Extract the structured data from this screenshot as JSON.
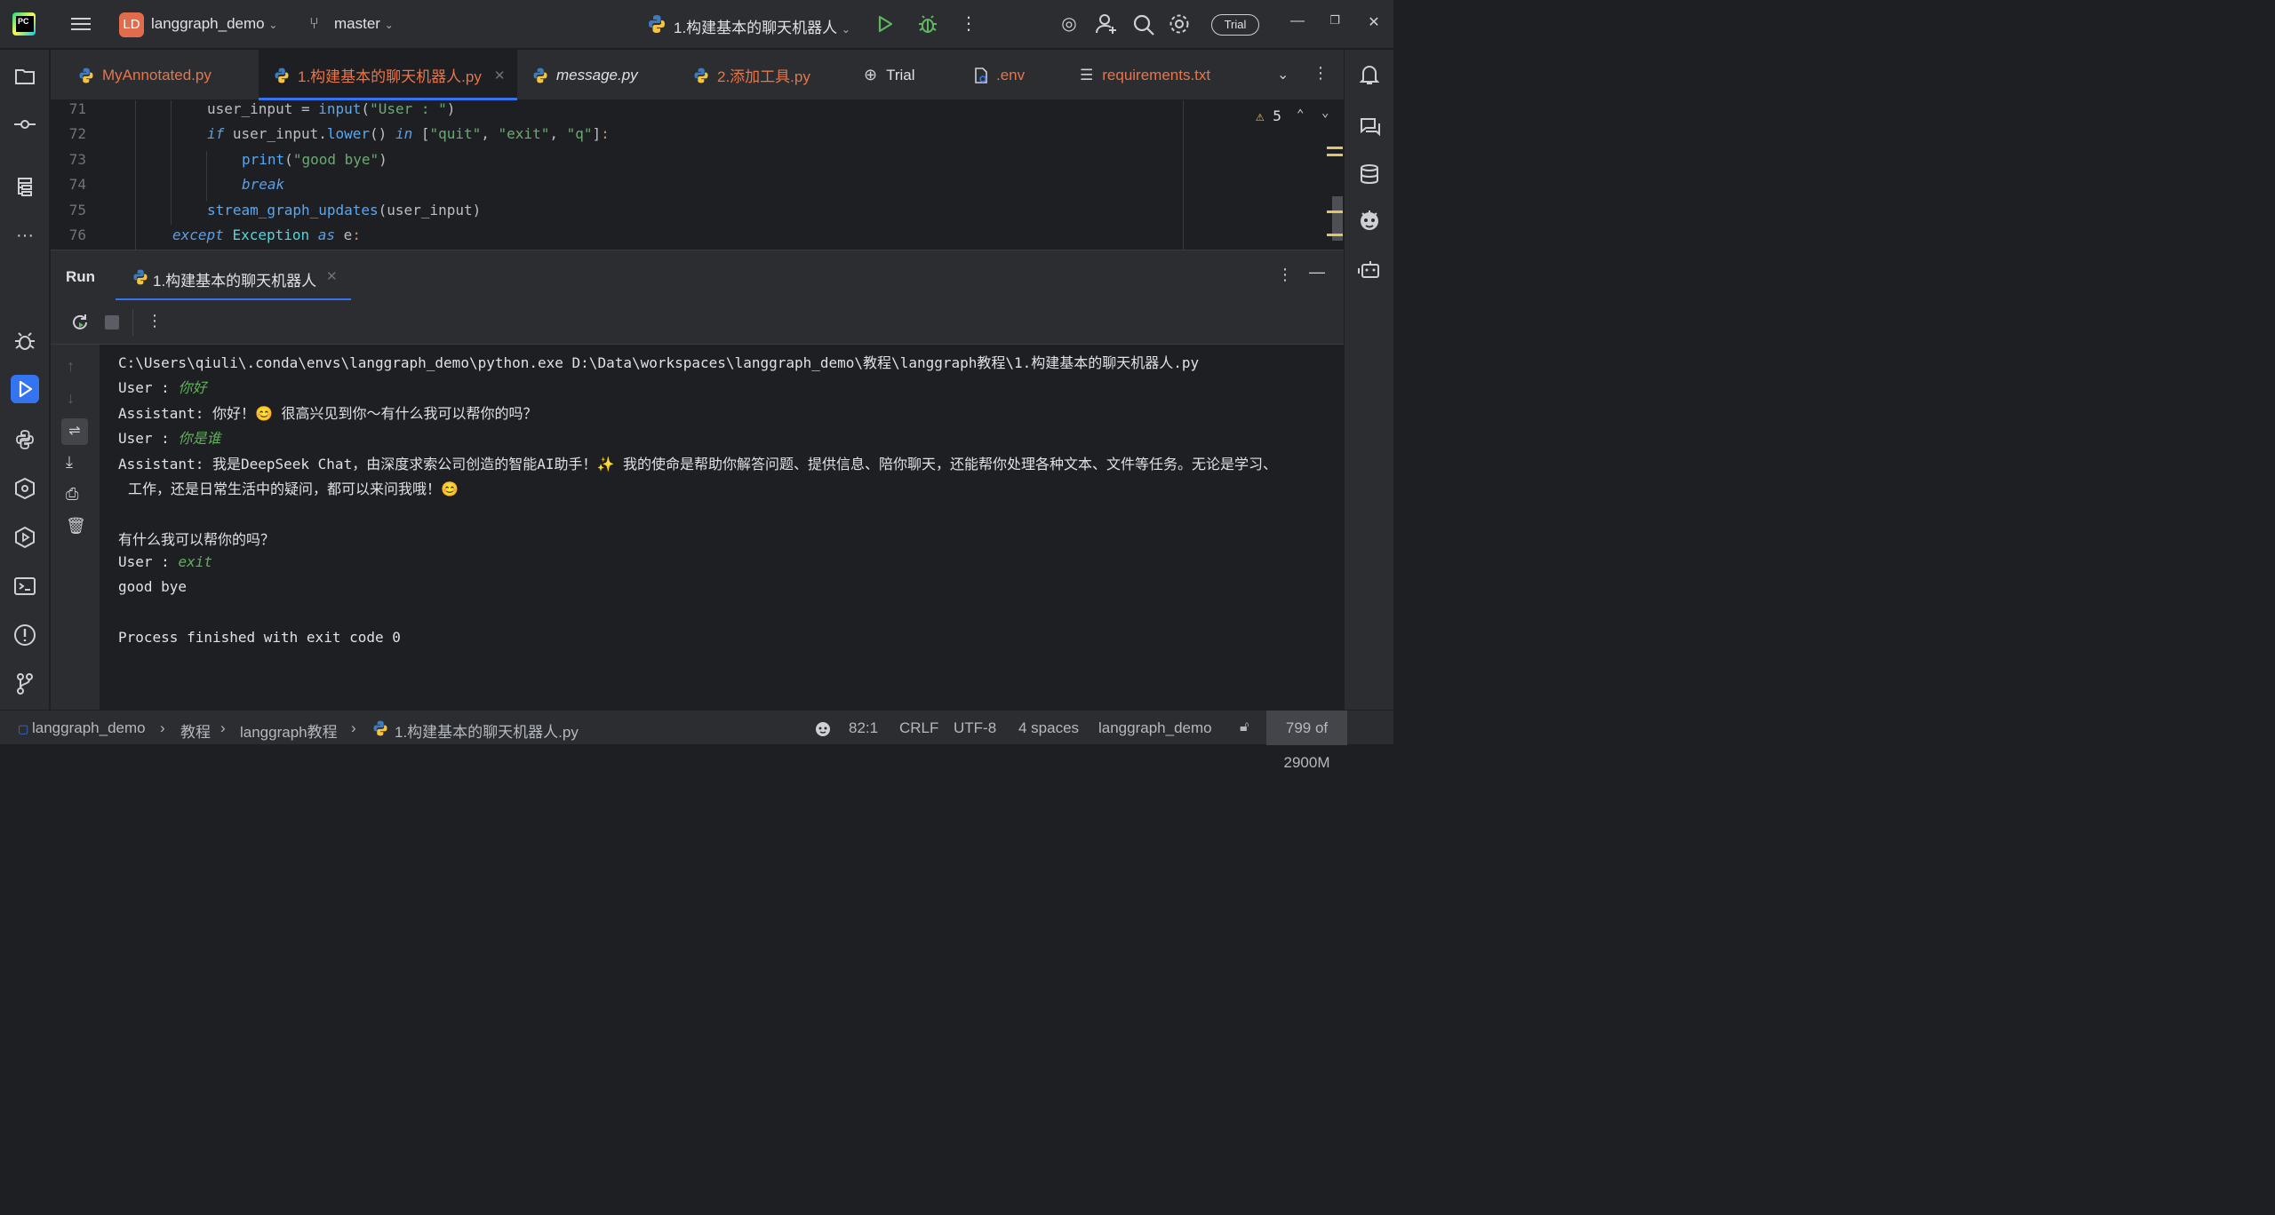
{
  "titlebar": {
    "project_badge": "LD",
    "project_name": "langgraph_demo",
    "branch": "master",
    "run_config": "1.构建基本的聊天机器人",
    "trial_label": "Trial"
  },
  "tabs": [
    {
      "label": "MyAnnotated.py"
    },
    {
      "label": "1.构建基本的聊天机器人.py"
    },
    {
      "label": "message.py"
    },
    {
      "label": "2.添加工具.py"
    },
    {
      "label": "Trial"
    },
    {
      "label": ".env"
    },
    {
      "label": "requirements.txt"
    }
  ],
  "editor": {
    "line_numbers": [
      "71",
      "72",
      "73",
      "74",
      "75",
      "76"
    ],
    "warnings_count": "5"
  },
  "run_panel": {
    "title": "Run",
    "tab_label": "1.构建基本的聊天机器人"
  },
  "console": {
    "command": "C:\\Users\\qiuli\\.conda\\envs\\langgraph_demo\\python.exe D:\\Data\\workspaces\\langgraph_demo\\教程\\langgraph教程\\1.构建基本的聊天机器人.py",
    "user_prefix": "User : ",
    "input1": "你好",
    "assistant_prefix": "Assistant: ",
    "reply1": "你好！😊 很高兴见到你～有什么我可以帮你的吗？",
    "input2": "你是谁",
    "reply2_line1": "我是DeepSeek Chat，由深度求索公司创造的智能AI助手！✨ 我的使命是帮助你解答问题、提供信息、陪你聊天，还能帮你处理各种文本、文件等任务。无论是学习、",
    "reply2_line2": "工作，还是日常生活中的疑问，都可以来问我哦！😊",
    "reply2_line3": "有什么我可以帮你的吗？",
    "input3": "exit",
    "output_bye": "good bye",
    "exit_msg": "Process finished with exit code 0"
  },
  "statusbar": {
    "breadcrumb": [
      "langgraph_demo",
      "教程",
      "langgraph教程",
      "1.构建基本的聊天机器人.py"
    ],
    "position": "82:1",
    "line_ending": "CRLF",
    "encoding": "UTF-8",
    "indent": "4 spaces",
    "interpreter": "langgraph_demo",
    "memory": "799 of 2900M"
  },
  "colors": {
    "accent": "#3574f0",
    "tab_modified": "#e8754a",
    "user_input": "#5fb257"
  }
}
